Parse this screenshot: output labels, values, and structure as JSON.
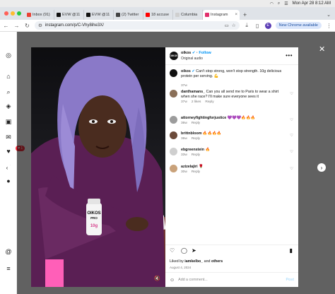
{
  "menubar": {
    "datetime": "Mon Apr 28  8:12 AM"
  },
  "tabs": [
    {
      "label": "Inbox (91)",
      "color": "#ea4335"
    },
    {
      "label": "EVW @11",
      "color": "#111111"
    },
    {
      "label": "EVW @11",
      "color": "#111111"
    },
    {
      "label": "(2) Twitter",
      "color": "#444444"
    },
    {
      "label": "18 accuse",
      "color": "#ff0000"
    },
    {
      "label": "Columbia",
      "color": "#cfcfcf"
    },
    {
      "label": "Instagram",
      "color": "#e1306c"
    }
  ],
  "toolbar": {
    "url": "instagram.com/p/C-Vhy8ihe3X/",
    "profile_initial": "E",
    "new_chrome_label": "New Chrome available"
  },
  "notifications": {
    "count": "1"
  },
  "post": {
    "username": "oikos",
    "follow_label": "Follow",
    "audio_label": "Original audio",
    "caption_user": "oikos",
    "caption_text": "Can't stop strong, won't stop strength. 10g delicious protein per serving. 💪",
    "caption_time": "37w",
    "image_text": {
      "brand": "OIKOS",
      "sub": "PRO",
      "protein": "10g"
    },
    "comments": [
      {
        "user": "danthamans_",
        "text": "Can you all send me to Paris to wear a shirt when she race? I'll make sure everyone sees it",
        "time": "37w",
        "likes": "2 likes",
        "reply": "Reply",
        "avatar_color": "#8a6f58"
      },
      {
        "user": "attorneyfightingforjustice",
        "text": "💜💜💜🔥🔥🔥",
        "time": "36w",
        "likes": "",
        "reply": "Reply",
        "avatar_color": "#9c9c9c"
      },
      {
        "user": "brittnbloom",
        "text": "🔥🔥🔥🔥",
        "time": "36w",
        "likes": "",
        "reply": "Reply",
        "avatar_color": "#6b4a3a"
      },
      {
        "user": "ebgreenstein",
        "text": "🔥",
        "time": "33w",
        "likes": "",
        "reply": "Reply",
        "avatar_color": "#cfcfcf"
      },
      {
        "user": "azizelajiri",
        "text": "🌹",
        "time": "30w",
        "likes": "",
        "reply": "Reply",
        "avatar_color": "#c9a27a"
      }
    ],
    "liked_by_prefix": "Liked by",
    "liked_by_user": "iamkelbo_",
    "liked_by_suffix": "and",
    "liked_by_others": "others",
    "date": "August 4, 2024",
    "add_comment_placeholder": "Add a comment...",
    "post_button": "Post"
  }
}
